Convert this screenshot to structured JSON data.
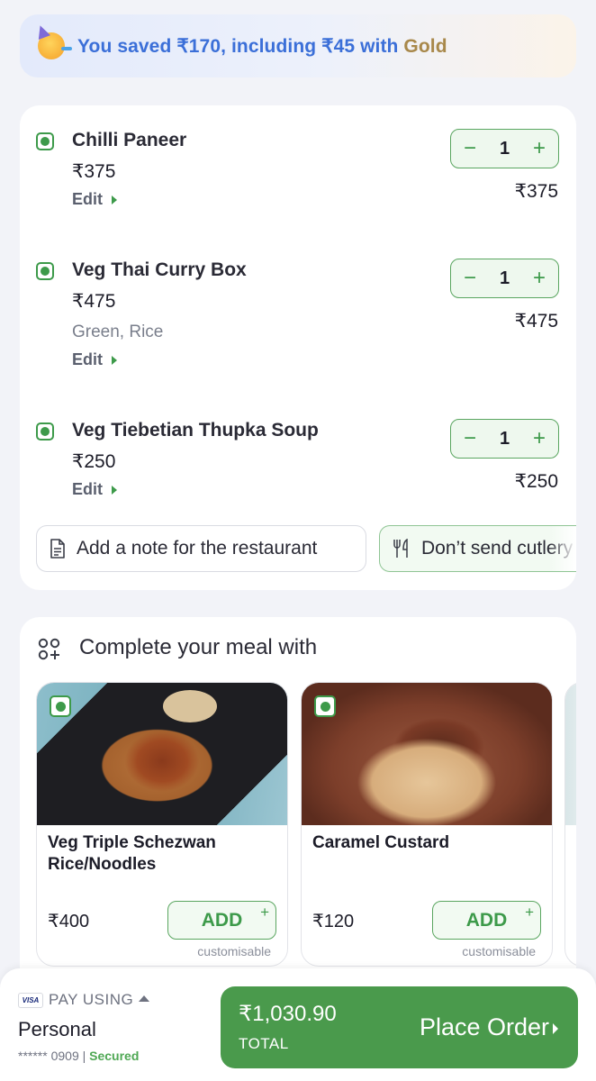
{
  "savings_banner": {
    "icon": "party-face-emoji",
    "text_prefix": "You saved ₹170, including ₹45 with ",
    "text_gold": "Gold"
  },
  "cart": {
    "items": [
      {
        "name": "Chilli Paneer",
        "price": "₹375",
        "description": "",
        "edit_label": "Edit",
        "quantity": "1",
        "line_total": "₹375",
        "veg": true
      },
      {
        "name": "Veg Thai Curry Box",
        "price": "₹475",
        "description": "Green, Rice",
        "edit_label": "Edit",
        "quantity": "1",
        "line_total": "₹475",
        "veg": true
      },
      {
        "name": "Veg Tiebetian Thupka Soup",
        "price": "₹250",
        "description": "",
        "edit_label": "Edit",
        "quantity": "1",
        "line_total": "₹250",
        "veg": true
      }
    ],
    "stepper": {
      "minus": "−",
      "plus": "+"
    },
    "note_chip": {
      "icon": "document-icon",
      "label": "Add a note for the restaurant"
    },
    "cutlery_chip": {
      "icon": "cutlery-icon",
      "label": "Don’t send cutlery"
    }
  },
  "recommendations": {
    "title": "Complete your meal with",
    "icon": "add-grid-icon",
    "items": [
      {
        "name": "Veg Triple Schezwan Rice/Noodles",
        "price": "₹400",
        "add_label": "ADD",
        "add_plus": "+",
        "note": "customisable",
        "veg": true
      },
      {
        "name": "Caramel Custard",
        "price": "₹120",
        "add_label": "ADD",
        "add_plus": "+",
        "note": "customisable",
        "veg": true
      }
    ]
  },
  "payment": {
    "card_brand": "VISA",
    "pay_using_label": "PAY USING",
    "method_name": "Personal",
    "card_masked": "****** 0909 | ",
    "secured_label": "Secured"
  },
  "place_order": {
    "total": "₹1,030.90",
    "total_label": "TOTAL",
    "label": "Place Order"
  }
}
